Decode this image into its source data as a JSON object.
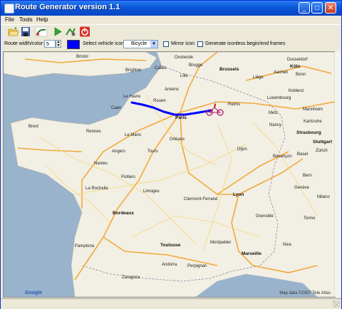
{
  "window": {
    "title": "Route Generator version 1.1",
    "minimize_label": "_",
    "maximize_label": "□",
    "close_label": "✕"
  },
  "menu": {
    "items": [
      {
        "label": "File"
      },
      {
        "label": "Tools"
      },
      {
        "label": "Help"
      }
    ]
  },
  "toolbar": {
    "buttons": [
      {
        "icon": "open-folder-icon"
      },
      {
        "icon": "save-disk-icon"
      },
      {
        "icon": "draw-route-icon"
      },
      {
        "icon": "play-icon"
      },
      {
        "icon": "route-tool-icon"
      },
      {
        "icon": "power-stop-icon"
      }
    ]
  },
  "options": {
    "route_label": "Route width/color:",
    "route_width": "5",
    "route_color": "#0000ff",
    "vehicle_label": "Select vehicle icon:",
    "vehicle_value": "Bicycle",
    "mirror_label": "Mirror icon",
    "mirror_checked": false,
    "iconless_label": "Generate iconless begin/end frames",
    "iconless_checked": false
  },
  "map": {
    "places": [
      {
        "name": "Bristol"
      },
      {
        "name": "Brighton"
      },
      {
        "name": "Oostende"
      },
      {
        "name": "Brugge"
      },
      {
        "name": "Brussels"
      },
      {
        "name": "Dusseldorf"
      },
      {
        "name": "Köln"
      },
      {
        "name": "Bonn"
      },
      {
        "name": "Koblenz"
      },
      {
        "name": "Lille"
      },
      {
        "name": "Calais"
      },
      {
        "name": "Liège"
      },
      {
        "name": "Aachen"
      },
      {
        "name": "Luxembourg"
      },
      {
        "name": "Le Havre"
      },
      {
        "name": "Rouen"
      },
      {
        "name": "Caen"
      },
      {
        "name": "Amiens"
      },
      {
        "name": "Reims"
      },
      {
        "name": "Metz"
      },
      {
        "name": "Nancy"
      },
      {
        "name": "Strasbourg"
      },
      {
        "name": "Mannheim"
      },
      {
        "name": "Karlsruhe"
      },
      {
        "name": "Stuttgart"
      },
      {
        "name": "Paris"
      },
      {
        "name": "Brest"
      },
      {
        "name": "Rennes"
      },
      {
        "name": "Le Mans"
      },
      {
        "name": "Orléans"
      },
      {
        "name": "Nantes"
      },
      {
        "name": "Angers"
      },
      {
        "name": "Tours"
      },
      {
        "name": "Dijon"
      },
      {
        "name": "Besançon"
      },
      {
        "name": "Basel"
      },
      {
        "name": "Zürich"
      },
      {
        "name": "Bern"
      },
      {
        "name": "La Rochelle"
      },
      {
        "name": "Poitiers"
      },
      {
        "name": "Limoges"
      },
      {
        "name": "Clermont-Ferrand"
      },
      {
        "name": "Lyon"
      },
      {
        "name": "Genève"
      },
      {
        "name": "Bordeaux"
      },
      {
        "name": "Toulouse"
      },
      {
        "name": "Montpellier"
      },
      {
        "name": "Marseille"
      },
      {
        "name": "Nice"
      },
      {
        "name": "Grenoble"
      },
      {
        "name": "Pamplona"
      },
      {
        "name": "Zaragoza"
      },
      {
        "name": "Andorra"
      },
      {
        "name": "Perpignan"
      },
      {
        "name": "Torino"
      },
      {
        "name": "Milano"
      }
    ],
    "copyright": "Map data ©2007 Tele Atlas",
    "logo": "Google",
    "vehicle_icon": "bicycle-icon"
  }
}
